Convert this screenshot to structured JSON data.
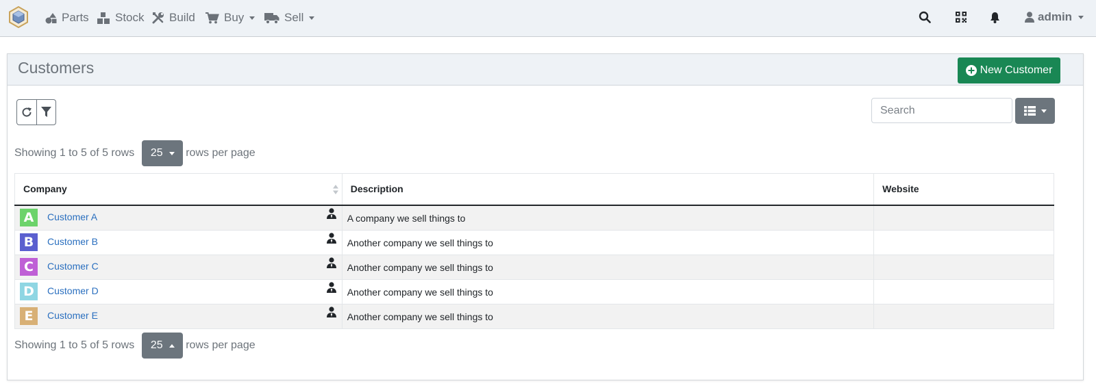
{
  "navbar": {
    "items": [
      {
        "label": "Parts",
        "icon": "shapes-icon"
      },
      {
        "label": "Stock",
        "icon": "boxes-icon"
      },
      {
        "label": "Build",
        "icon": "tools-icon"
      },
      {
        "label": "Buy",
        "icon": "shopping-cart-icon",
        "dropdown": true
      },
      {
        "label": "Sell",
        "icon": "truck-icon",
        "dropdown": true
      }
    ],
    "user": "admin",
    "right_icons": [
      "search-icon",
      "qrcode-icon",
      "bell-icon"
    ]
  },
  "page": {
    "title": "Customers",
    "new_button_label": "New Customer"
  },
  "toolbar": {
    "search_placeholder": "Search"
  },
  "pagination": {
    "info": "Showing 1 to 5 of 5 rows",
    "page_size": "25",
    "suffix": "rows per page"
  },
  "table": {
    "columns": [
      "Company",
      "Description",
      "Website"
    ],
    "rows": [
      {
        "letter": "A",
        "color": "#6cd36b",
        "name": "Customer A",
        "description": "A company we sell things to",
        "website": ""
      },
      {
        "letter": "B",
        "color": "#5b5fcf",
        "name": "Customer B",
        "description": "Another company we sell things to",
        "website": ""
      },
      {
        "letter": "C",
        "color": "#bf5fd6",
        "name": "Customer C",
        "description": "Another company we sell things to",
        "website": ""
      },
      {
        "letter": "D",
        "color": "#8fd6e3",
        "name": "Customer D",
        "description": "Another company we sell things to",
        "website": ""
      },
      {
        "letter": "E",
        "color": "#d8b076",
        "name": "Customer E",
        "description": "Another company we sell things to",
        "website": ""
      }
    ]
  },
  "colors": {
    "navbar_bg": "#eef2f6",
    "primary_success": "#198754",
    "secondary": "#6c757d",
    "link": "#2a6fbf"
  }
}
